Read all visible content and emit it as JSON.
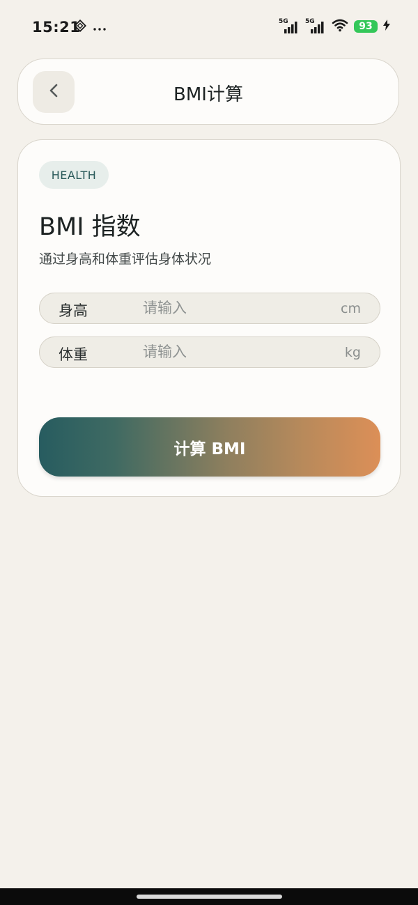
{
  "status_bar": {
    "time": "15:21",
    "network_1": "5G",
    "network_2": "5G",
    "battery": "93",
    "icons": [
      "dnd-diamond-icon",
      "more-dots-icon",
      "signal-icon",
      "wifi-icon",
      "battery-icon",
      "charging-bolt-icon"
    ]
  },
  "header": {
    "title": "BMI计算",
    "back_icon": "chevron-left-icon"
  },
  "card": {
    "badge": "HEALTH",
    "title": "BMI 指数",
    "subtitle": "通过身高和体重评估身体状况",
    "fields": [
      {
        "label": "身高",
        "placeholder": "请输入",
        "value": "",
        "unit": "cm"
      },
      {
        "label": "体重",
        "placeholder": "请输入",
        "value": "",
        "unit": "kg"
      }
    ],
    "button_label": "计算 BMI"
  },
  "colors": {
    "background": "#f4f1eb",
    "card": "#fdfcfa",
    "gradient_start": "#275c60",
    "gradient_end": "#dc8f57",
    "battery": "#34c759"
  }
}
